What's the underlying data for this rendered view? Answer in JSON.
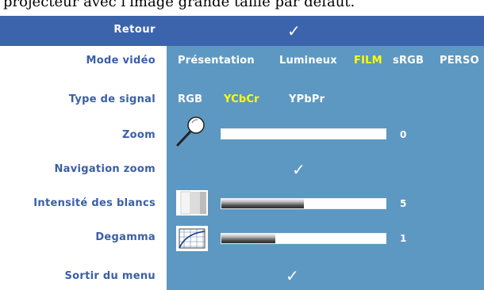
{
  "top_strip": {
    "text": "projecteur avec l'image grande taille par défaut."
  },
  "header": {
    "label": "Retour",
    "check": "✓"
  },
  "rows": {
    "video_mode": {
      "label": "Mode vidéo",
      "options": [
        "Présentation",
        "Lumineux",
        "FILM",
        "sRGB",
        "PERSO"
      ],
      "selected": "FILM"
    },
    "signal_type": {
      "label": "Type de signal",
      "options": [
        "RGB",
        "YCbCr",
        "YPbPr"
      ],
      "selected": "YCbCr"
    },
    "zoom": {
      "label": "Zoom",
      "value": "0",
      "level": 0
    },
    "zoom_nav": {
      "label": "Navigation zoom",
      "check": "✓"
    },
    "white_intensity": {
      "label": "Intensité des blancs",
      "value": "5",
      "level": 0.5
    },
    "degamma": {
      "label": "Degamma",
      "value": "1",
      "level": 0.33
    },
    "exit": {
      "label": "Sortir du menu",
      "check": "✓"
    }
  },
  "colors": {
    "header_bg": "#3c64ad",
    "panel_bg": "#5d98c2",
    "label_text": "#3a5fa6",
    "selected_option": "#ffff00"
  },
  "icons": [
    "magnifier-icon",
    "white-intensity-icon",
    "degamma-curve-icon",
    "checkmark-icon"
  ]
}
